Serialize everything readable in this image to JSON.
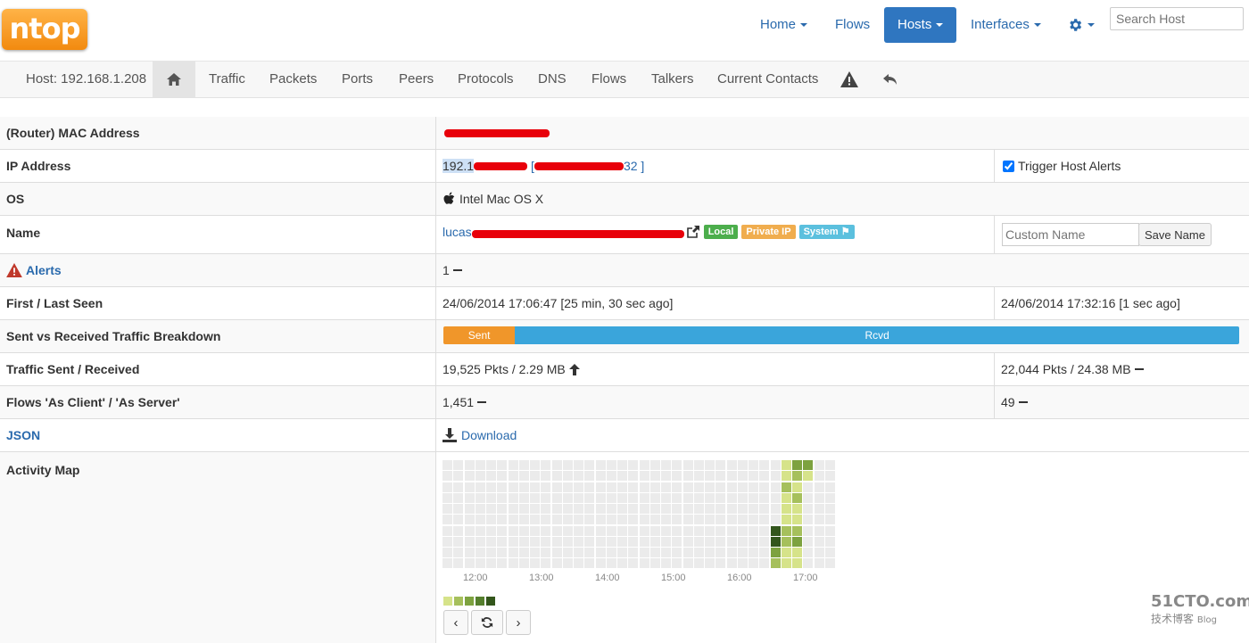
{
  "brand": {
    "logo_text": "ntop",
    "logo_color": "#f28a0f"
  },
  "nav": {
    "home": "Home",
    "flows": "Flows",
    "hosts": "Hosts",
    "interfaces": "Interfaces",
    "settings_icon": "gear-icon",
    "search_placeholder": "Search Host",
    "active_color": "#2f76c0"
  },
  "subnav": {
    "host_label": "Host: 192.168.1.208",
    "home_icon": "home-icon",
    "tabs": [
      "Traffic",
      "Packets",
      "Ports",
      "Peers",
      "Protocols",
      "DNS",
      "Flows",
      "Talkers",
      "Current Contacts"
    ],
    "alert_icon": "warning-icon",
    "back_icon": "undo-icon"
  },
  "rows": {
    "mac": {
      "label": "(Router) MAC Address"
    },
    "ip": {
      "label": "IP Address",
      "value_prefix": "192.1",
      "value_suffix": "32 ]",
      "trigger_alerts": "Trigger Host Alerts",
      "trigger_checked": true
    },
    "os": {
      "label": "OS",
      "value": "Intel Mac OS X",
      "icon": "apple-icon"
    },
    "name": {
      "label": "Name",
      "value_prefix": "lucas",
      "badges": [
        "Local",
        "Private IP",
        "System"
      ],
      "custom_placeholder": "Custom Name",
      "save_label": "Save Name"
    },
    "alerts": {
      "label": "Alerts",
      "value": "1"
    },
    "seen": {
      "label": "First / Last Seen",
      "first": "24/06/2014 17:06:47 [25 min, 30 sec ago]",
      "last": "24/06/2014 17:32:16 [1 sec ago]"
    },
    "breakdown": {
      "label": "Sent vs Received Traffic Breakdown",
      "sent_label": "Sent",
      "rcvd_label": "Rcvd",
      "sent_fraction": 0.09,
      "sent_color": "#f0962a",
      "rcvd_color": "#3aa5db"
    },
    "traffic": {
      "label": "Traffic Sent / Received",
      "sent": "19,525 Pkts / 2.29 MB",
      "received": "22,044 Pkts / 24.38 MB"
    },
    "flows": {
      "label": "Flows 'As Client' / 'As Server'",
      "client": "1,451",
      "server": "49"
    },
    "json": {
      "label": "JSON",
      "download": "Download"
    },
    "activity": {
      "label": "Activity Map",
      "ticks": [
        "12:00",
        "13:00",
        "14:00",
        "15:00",
        "16:00",
        "17:00"
      ]
    }
  },
  "watermark": {
    "line1": "51CTO.com",
    "line2": "技术博客",
    "line3": "Blog"
  }
}
